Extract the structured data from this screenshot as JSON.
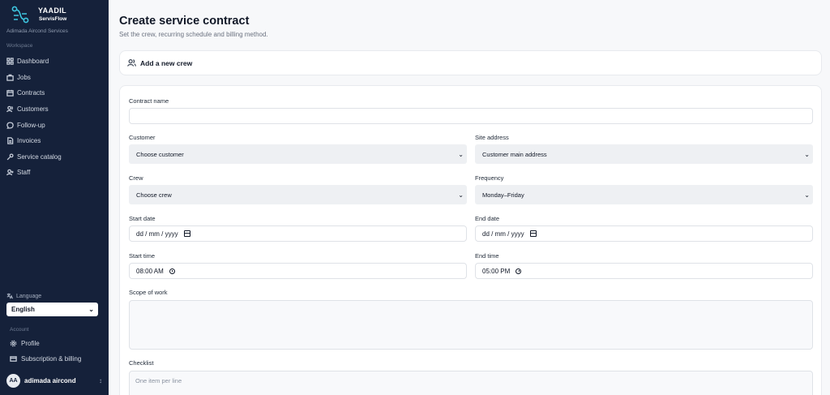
{
  "brand": {
    "name": "YAADIL",
    "product": "ServisFlow"
  },
  "org_name": "Adimada Aircond Services",
  "sidebar": {
    "workspace_label": "Workspace",
    "items": [
      {
        "label": "Dashboard",
        "icon": "grid-icon"
      },
      {
        "label": "Jobs",
        "icon": "briefcase-icon"
      },
      {
        "label": "Contracts",
        "icon": "calendar-icon"
      },
      {
        "label": "Customers",
        "icon": "users-icon"
      },
      {
        "label": "Follow-up",
        "icon": "chat-icon"
      },
      {
        "label": "Invoices",
        "icon": "file-icon"
      },
      {
        "label": "Service catalog",
        "icon": "wrench-icon"
      },
      {
        "label": "Staff",
        "icon": "user-plus-icon"
      }
    ],
    "language_label": "Language",
    "language_value": "English",
    "account_label": "Account",
    "account_items": [
      {
        "label": "Profile",
        "icon": "gear-icon"
      },
      {
        "label": "Subscription & billing",
        "icon": "card-icon"
      }
    ],
    "user": {
      "initials": "AA",
      "name": "adimada aircond"
    }
  },
  "page": {
    "title": "Create service contract",
    "subtitle": "Set the crew, recurring schedule and billing method."
  },
  "crew_card": {
    "label": "Add a new crew"
  },
  "form": {
    "contract_name": {
      "label": "Contract name",
      "value": ""
    },
    "customer": {
      "label": "Customer",
      "value": "Choose customer"
    },
    "site_address": {
      "label": "Site address",
      "value": "Customer main address"
    },
    "crew": {
      "label": "Crew",
      "value": "Choose crew"
    },
    "frequency": {
      "label": "Frequency",
      "value": "Monday–Friday"
    },
    "start_date": {
      "label": "Start date",
      "value": "dd / mm / yyyy"
    },
    "end_date": {
      "label": "End date",
      "value": "dd / mm / yyyy"
    },
    "start_time": {
      "label": "Start time",
      "value": "08:00 AM"
    },
    "end_time": {
      "label": "End time",
      "value": "05:00 PM"
    },
    "scope": {
      "label": "Scope of work",
      "value": ""
    },
    "checklist": {
      "label": "Checklist",
      "placeholder": "One item per line"
    }
  },
  "colors": {
    "sidebar_bg": "#15213a",
    "accent": "#3ec6e0",
    "main_bg": "#f7f8fa"
  }
}
